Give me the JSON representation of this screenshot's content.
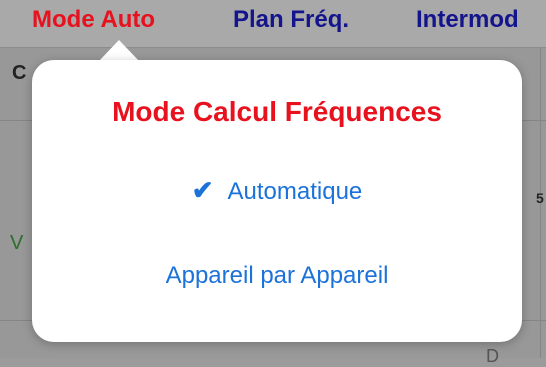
{
  "colors": {
    "title_red": "#e8111e",
    "tab_navy": "#14148c",
    "link_blue": "#1b72d9"
  },
  "tabs": [
    {
      "label": "Mode Auto"
    },
    {
      "label": "Plan Fréq."
    },
    {
      "label": "Intermod"
    }
  ],
  "background": {
    "left_header_text": "C",
    "left_green_text": "V",
    "right_text_1": "5",
    "right_text_2": "D"
  },
  "popover": {
    "title": "Mode Calcul Fréquences",
    "options": [
      {
        "label": "Automatique",
        "selected": true,
        "icon": "checkmark-icon"
      },
      {
        "label": "Appareil par Appareil",
        "selected": false
      }
    ]
  }
}
